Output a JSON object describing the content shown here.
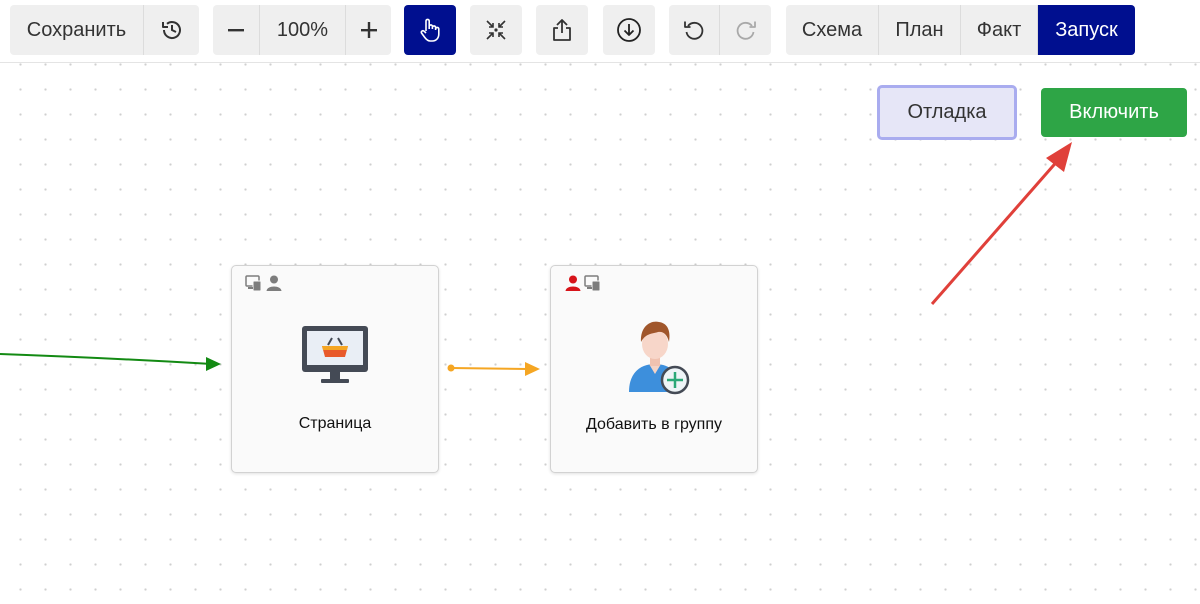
{
  "toolbar": {
    "save_label": "Сохранить",
    "zoom_value": "100%",
    "views": [
      {
        "label": "Схема",
        "active": false
      },
      {
        "label": "План",
        "active": false
      },
      {
        "label": "Факт",
        "active": false
      },
      {
        "label": "Запуск",
        "active": true
      }
    ]
  },
  "actions": {
    "debug_label": "Отладка",
    "enable_label": "Включить"
  },
  "nodes": [
    {
      "label": "Страница",
      "icon": "monitor-basket-icon",
      "badges": [
        "devices-icon",
        "user-gray-icon"
      ]
    },
    {
      "label": "Добавить в группу",
      "icon": "user-add-icon",
      "badges": [
        "user-red-icon",
        "devices-icon"
      ]
    }
  ],
  "colors": {
    "accent": "#000f8f",
    "enable": "#2ea546",
    "debug_border": "#a9acef",
    "incoming_wire": "#138a13",
    "connection_wire": "#f5a623",
    "annotation_arrow": "#e0403a"
  }
}
